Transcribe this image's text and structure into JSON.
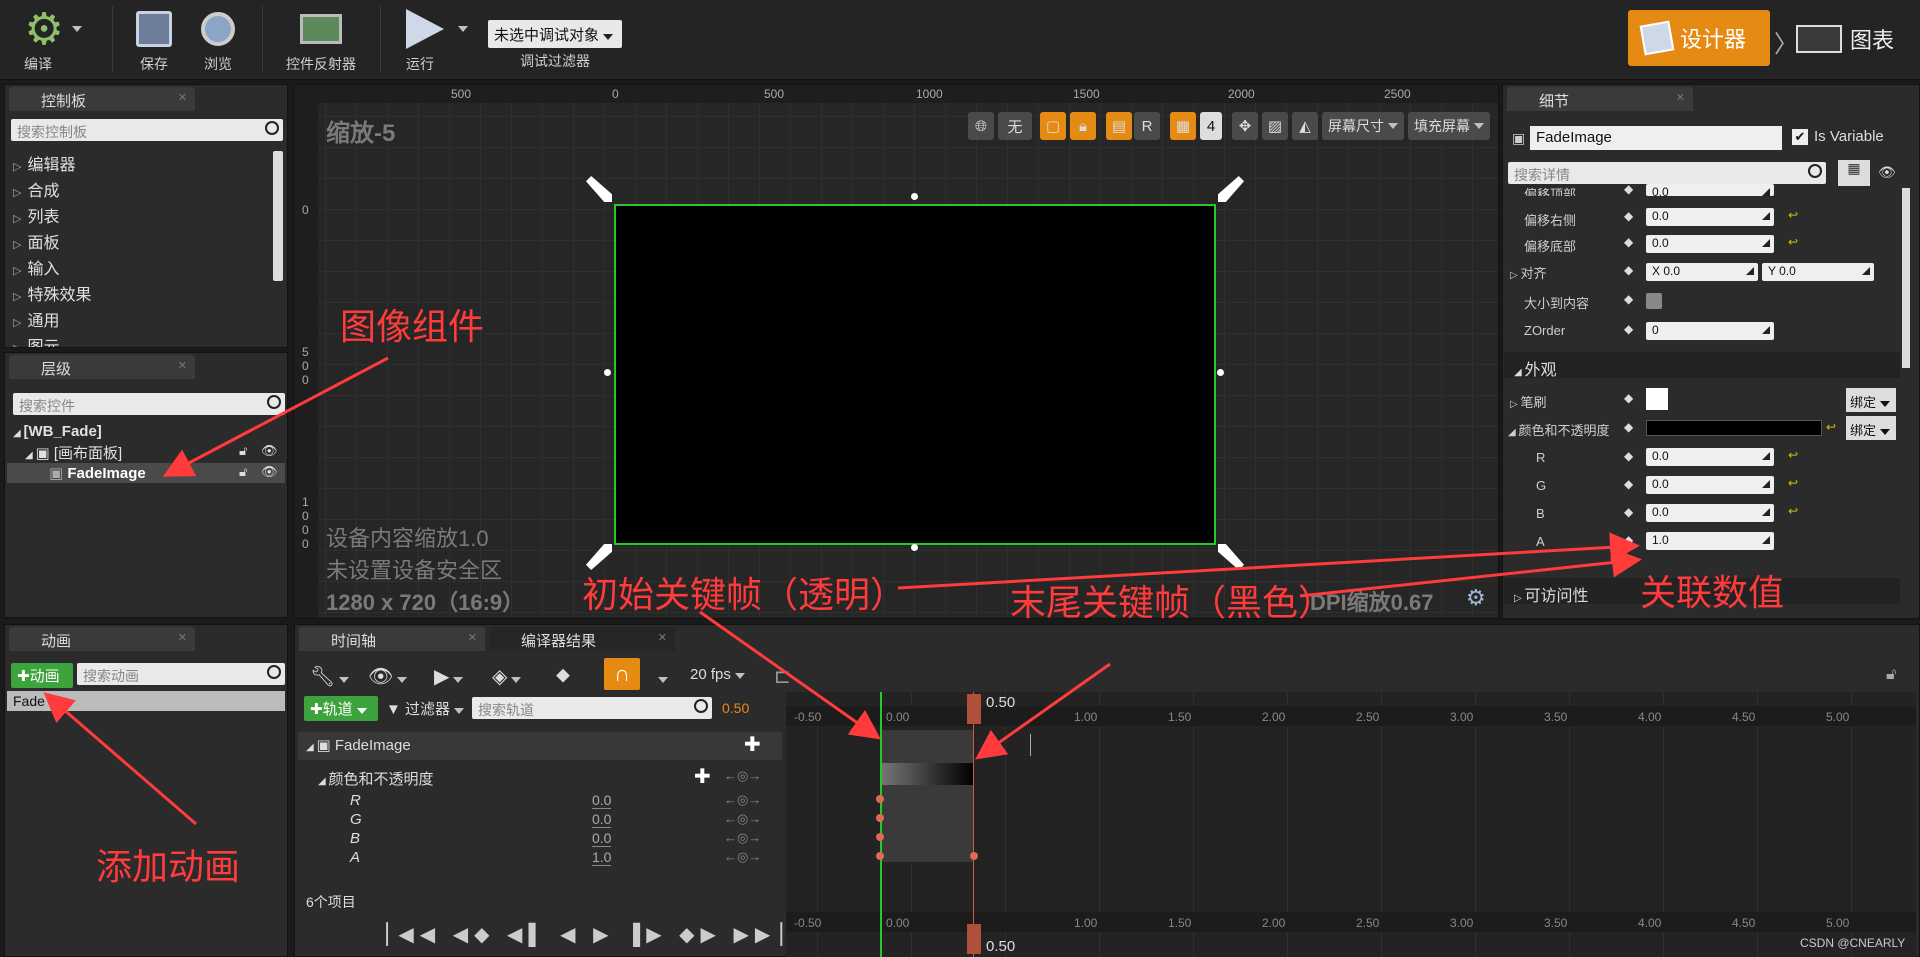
{
  "toolbar": {
    "compile": "编译",
    "save": "保存",
    "browse": "浏览",
    "reflector": "控件反射器",
    "run": "运行",
    "debug_select": "未选中调试对象",
    "debug_filter": "调试过滤器",
    "designer": "设计器",
    "graph": "图表"
  },
  "palette": {
    "tab": "控制板",
    "search_placeholder": "搜索控制板",
    "items": [
      "编辑器",
      "合成",
      "列表",
      "面板",
      "输入",
      "特殊效果",
      "通用",
      "图元"
    ]
  },
  "hierarchy": {
    "tab": "层级",
    "search_placeholder": "搜索控件",
    "root": "[WB_Fade]",
    "canvas": "[画布面板]",
    "image": "FadeImage"
  },
  "viewport": {
    "zoom": "缩放-5",
    "ruler_top": [
      "500",
      "0",
      "500",
      "1000",
      "1500",
      "2000",
      "2500"
    ],
    "ruler_left": [
      "0",
      "5",
      "0",
      "0",
      "1",
      "0",
      "0",
      "0"
    ],
    "tool_none": "无",
    "tool_r": "R",
    "tool_grid": "4",
    "screen_size": "屏幕尺寸",
    "fill_screen": "填充屏幕",
    "info1": "设备内容缩放1.0",
    "info2": "未设置设备安全区",
    "info3": "1280 x 720（16:9）",
    "dpi": "DPI缩放0.67"
  },
  "details": {
    "tab": "细节",
    "name": "FadeImage",
    "is_variable": "Is Variable",
    "search_placeholder": "搜索详情",
    "rows": [
      {
        "label": "偏移顶部",
        "value": "0.0"
      },
      {
        "label": "偏移右侧",
        "value": "0.0"
      },
      {
        "label": "偏移底部",
        "value": "0.0"
      }
    ],
    "align": "对齐",
    "align_x": "X  0.0",
    "align_y": "Y  0.0",
    "size_to_content": "大小到内容",
    "zorder": "ZOrder",
    "zorder_value": "0",
    "appearance": "外观",
    "brush": "笔刷",
    "bind": "绑定",
    "color_opacity": "颜色和不透明度",
    "r": "R",
    "r_val": "0.0",
    "g": "G",
    "g_val": "0.0",
    "b": "B",
    "b_val": "0.0",
    "a": "A",
    "a_val": "1.0",
    "accessibility": "可访问性"
  },
  "animation": {
    "tab": "动画",
    "add_button": "动画",
    "search_placeholder": "搜索动画",
    "item": "Fade"
  },
  "timeline": {
    "tab1": "时间轴",
    "tab2": "编译器结果",
    "fps": "20 fps",
    "track_button": "轨道",
    "filter": "过滤器",
    "search_placeholder": "搜索轨道",
    "time_value": "0.50",
    "track_name": "FadeImage",
    "property": "颜色和不透明度",
    "channels": [
      {
        "name": "R",
        "value": "0.0"
      },
      {
        "name": "G",
        "value": "0.0"
      },
      {
        "name": "B",
        "value": "0.0"
      },
      {
        "name": "A",
        "value": "1.0"
      }
    ],
    "item_count": "6个项目",
    "ticks": [
      "-0.50",
      "0.00",
      "0.50",
      "1.00",
      "1.50",
      "2.00",
      "2.50",
      "3.00",
      "3.50",
      "4.00",
      "4.50",
      "5.00"
    ],
    "playhead": "0.50"
  },
  "annotations": {
    "image_component": "图像组件",
    "start_key": "初始关键帧（透明）",
    "end_key": "末尾关键帧（黑色）",
    "linked_value": "关联数值",
    "add_animation": "添加动画"
  },
  "watermark": "CSDN @CNEARLY",
  "colors": {
    "accent": "#e58a13",
    "annotation": "#ff3b3b",
    "selection_green": "#28c828"
  }
}
